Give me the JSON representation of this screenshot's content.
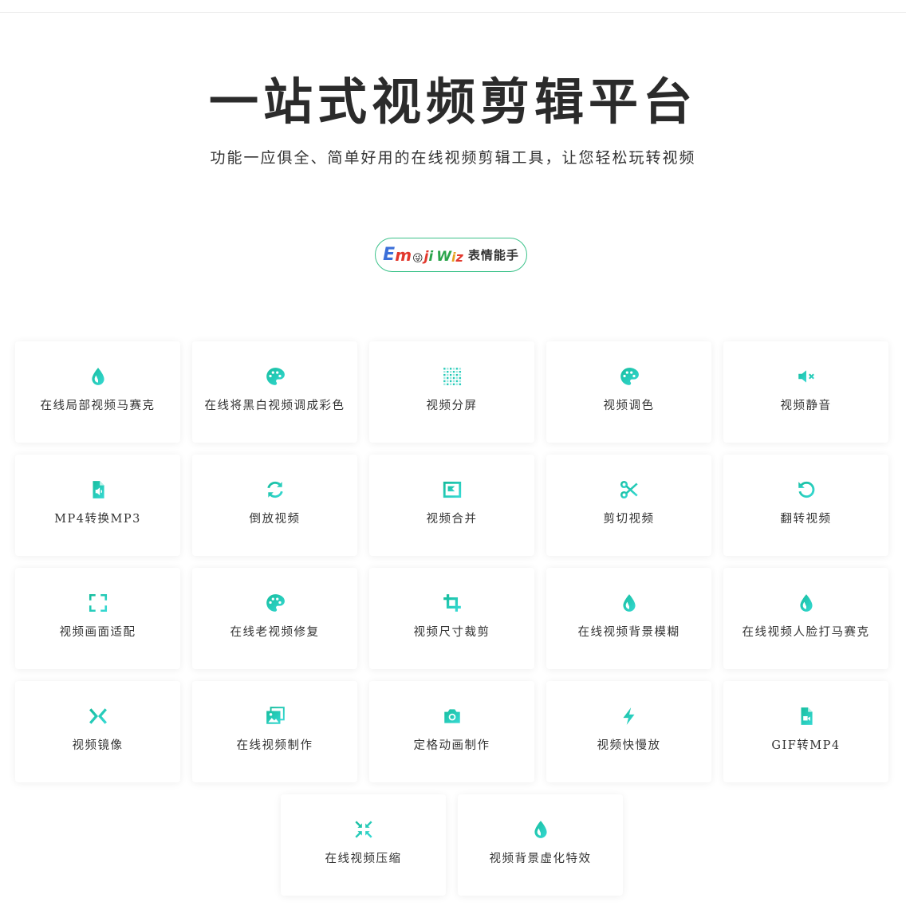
{
  "hero": {
    "title": "一站式视频剪辑平台",
    "subtitle": "功能一应俱全、简单好用的在线视频剪辑工具，让您轻松玩转视频"
  },
  "promo": {
    "logo_letters": [
      "E",
      "m",
      "😜",
      "j",
      "i",
      "W",
      "i",
      "z"
    ],
    "text": "表情能手"
  },
  "colors": {
    "accent_start": "#19c1a4",
    "accent_end": "#2fd6cf",
    "promo_border": "#3cc28a"
  },
  "tools": [
    {
      "label": "在线局部视频马赛克",
      "icon": "drop-icon"
    },
    {
      "label": "在线将黑白视频调成彩色",
      "icon": "palette-icon"
    },
    {
      "label": "视频分屏",
      "icon": "grid-dots-icon"
    },
    {
      "label": "视频调色",
      "icon": "palette-icon"
    },
    {
      "label": "视频静音",
      "icon": "mute-icon"
    },
    {
      "label": "MP4转换MP3",
      "icon": "audio-file-icon"
    },
    {
      "label": "倒放视频",
      "icon": "refresh-icon"
    },
    {
      "label": "视频合并",
      "icon": "merge-frame-icon"
    },
    {
      "label": "剪切视频",
      "icon": "scissors-icon"
    },
    {
      "label": "翻转视频",
      "icon": "rotate-icon"
    },
    {
      "label": "视频画面适配",
      "icon": "fullscreen-icon"
    },
    {
      "label": "在线老视频修复",
      "icon": "palette-icon"
    },
    {
      "label": "视频尺寸裁剪",
      "icon": "crop-icon"
    },
    {
      "label": "在线视频背景模糊",
      "icon": "drop-icon"
    },
    {
      "label": "在线视频人脸打马赛克",
      "icon": "drop-icon"
    },
    {
      "label": "视频镜像",
      "icon": "mirror-icon"
    },
    {
      "label": "在线视频制作",
      "icon": "images-icon"
    },
    {
      "label": "定格动画制作",
      "icon": "camera-icon"
    },
    {
      "label": "视频快慢放",
      "icon": "bolt-icon"
    },
    {
      "label": "GIF转MP4",
      "icon": "video-file-icon"
    },
    {
      "label": "在线视频压缩",
      "icon": "compress-icon"
    },
    {
      "label": "视频背景虚化特效",
      "icon": "drop-icon"
    }
  ]
}
